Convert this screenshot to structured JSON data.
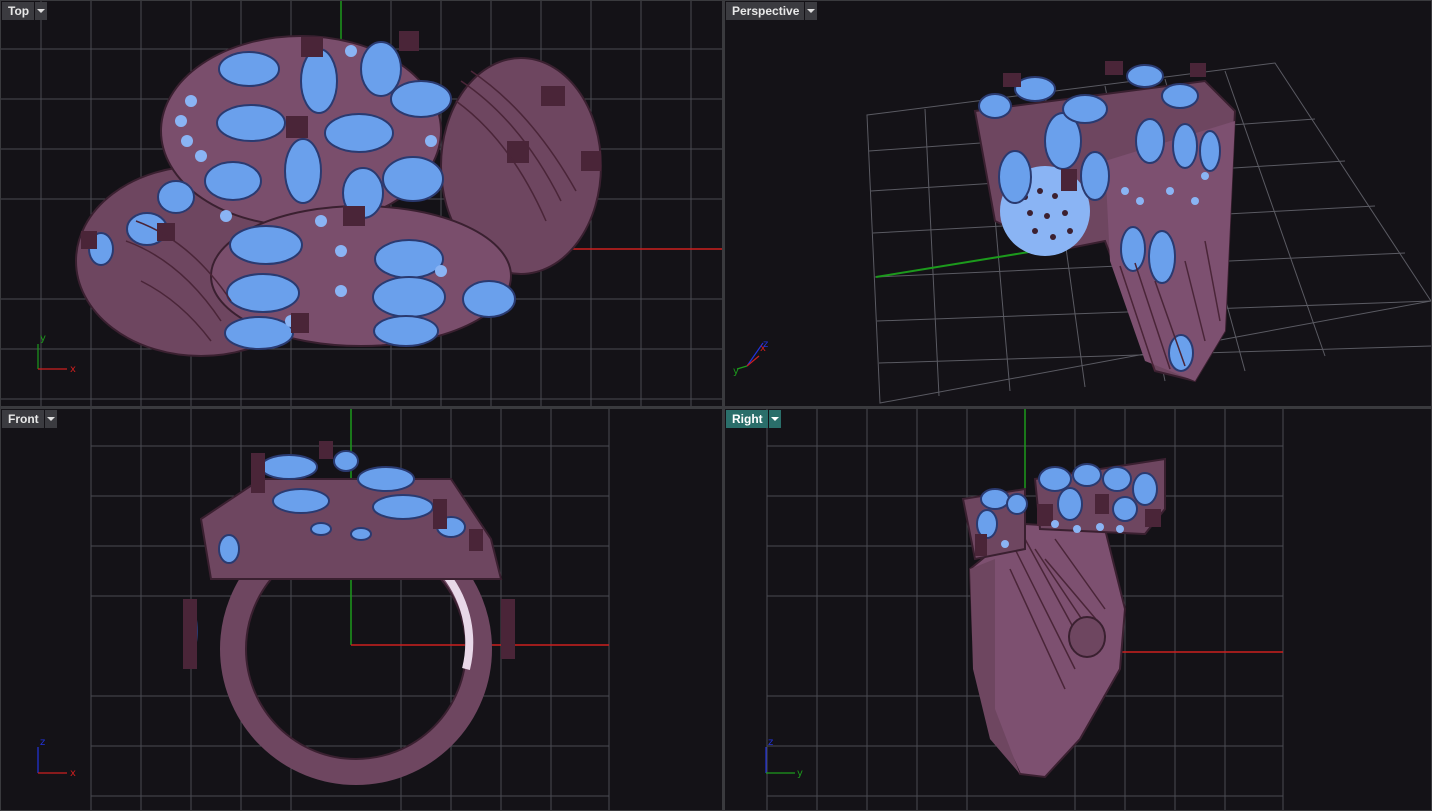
{
  "viewports": {
    "top": {
      "title": "Top",
      "active": false
    },
    "perspective": {
      "title": "Perspective",
      "active": false
    },
    "front": {
      "title": "Front",
      "active": false
    },
    "right": {
      "title": "Right",
      "active": true
    }
  },
  "axis_labels": {
    "top": {
      "horizontal": "x",
      "vertical": "y"
    },
    "perspective": {
      "a": "x",
      "b": "z",
      "c": "y"
    },
    "front": {
      "horizontal": "x",
      "vertical": "z"
    },
    "right": {
      "horizontal": "y",
      "vertical": "z"
    }
  },
  "icons": {
    "dropdown": "chevron-down-icon"
  },
  "colors": {
    "background": "#141217",
    "grid": "#4a4a52",
    "x_axis": "#cc1f1f",
    "y_axis": "#1c9a1c",
    "z_axis": "#2233dd",
    "metal": "#8a5a78",
    "gem": "#6a9ee8",
    "active_tab": "#2a6e6a"
  }
}
